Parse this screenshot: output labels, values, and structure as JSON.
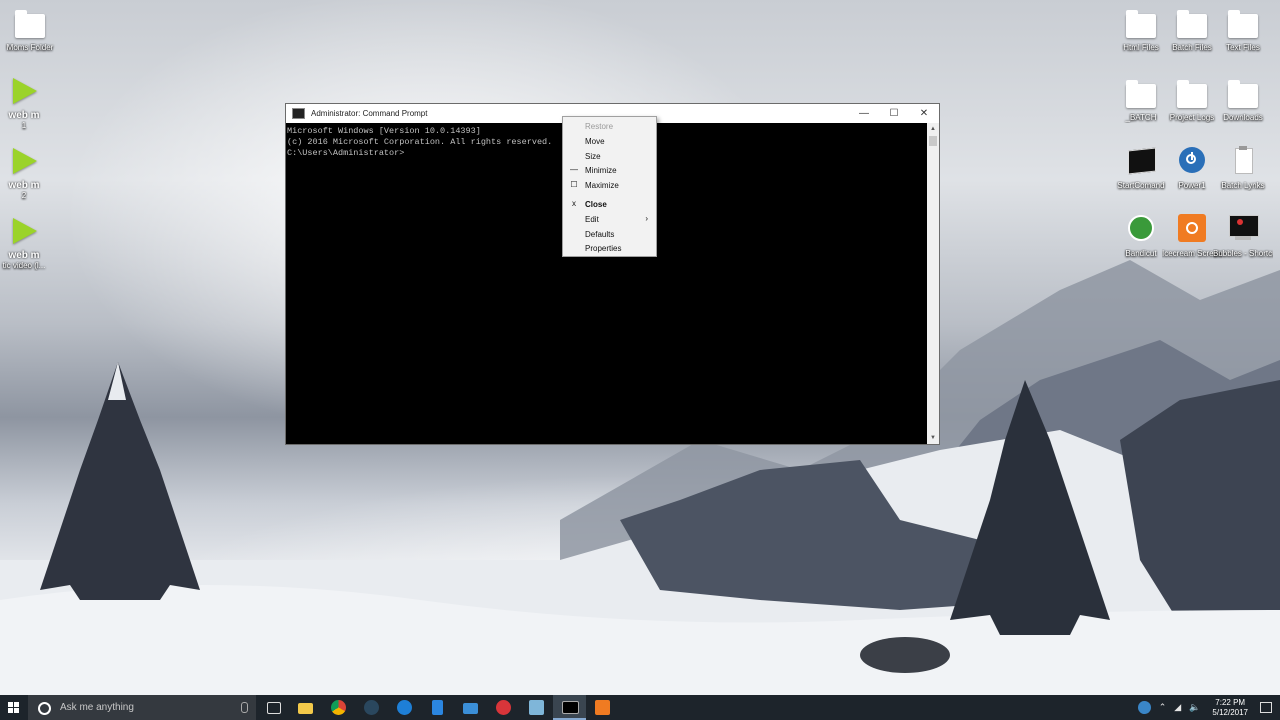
{
  "desktop": {
    "left_icons": [
      {
        "label": "Moms Folder",
        "type": "folder"
      },
      {
        "label": "web m",
        "sub": "1",
        "type": "play"
      },
      {
        "label": "web m",
        "sub": "2",
        "type": "play"
      },
      {
        "label": "web m",
        "sub": "tic video (l...",
        "type": "play"
      }
    ],
    "right_icons": [
      {
        "label": "Html Files",
        "type": "folder"
      },
      {
        "label": "Batch Files",
        "type": "folder"
      },
      {
        "label": "Text Files",
        "type": "folder"
      },
      {
        "label": "_BATCH",
        "type": "folder"
      },
      {
        "label": "Project Logs",
        "type": "folder"
      },
      {
        "label": "Downloads",
        "type": "folder"
      },
      {
        "label": "StartComand",
        "type": "cmd"
      },
      {
        "label": "Power1",
        "type": "power"
      },
      {
        "label": "Batch Lynks",
        "type": "doc"
      },
      {
        "label": "Bandicut",
        "type": "bandicut"
      },
      {
        "label": "Icecream Screen ...",
        "type": "icecream"
      },
      {
        "label": "Bubbles - Shortcut",
        "type": "bubbles"
      }
    ]
  },
  "cmd_window": {
    "title": "Administrator: Command Prompt",
    "lines": [
      "Microsoft Windows [Version 10.0.14393]",
      "(c) 2016 Microsoft Corporation. All rights reserved.",
      "",
      "C:\\Users\\Administrator>"
    ],
    "minimize": "—",
    "maximize": "☐",
    "close": "✕"
  },
  "system_menu": {
    "items": [
      {
        "label": "Restore",
        "disabled": true
      },
      {
        "label": "Move"
      },
      {
        "label": "Size"
      },
      {
        "label": "Minimize",
        "mark": "—"
      },
      {
        "label": "Maximize",
        "mark": "☐"
      },
      {
        "label": "Close",
        "mark": "x",
        "bold": true
      },
      {
        "label": "Edit",
        "submenu": true
      },
      {
        "label": "Defaults"
      },
      {
        "label": "Properties"
      }
    ]
  },
  "taskbar": {
    "search_placeholder": "Ask me anything",
    "clock_time": "7:22 PM",
    "clock_date": "5/12/2017",
    "colors": {
      "bg": "#1d242b",
      "accent": "#86a9d1"
    }
  }
}
